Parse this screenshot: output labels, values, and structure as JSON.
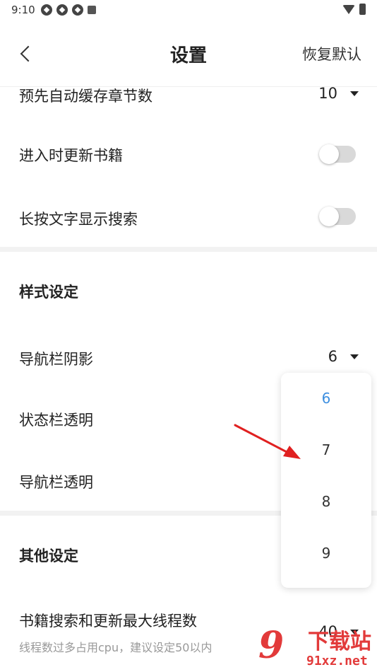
{
  "status_bar": {
    "time": "9:10"
  },
  "header": {
    "title": "设置",
    "restore_label": "恢复默认"
  },
  "settings": {
    "preload_chapters": {
      "label": "预先自动缓存章节数",
      "value": "10"
    },
    "update_on_enter": {
      "label": "进入时更新书籍",
      "on": false
    },
    "long_press_search": {
      "label": "长按文字显示搜索",
      "on": false
    },
    "style_section": "样式设定",
    "nav_shadow": {
      "label": "导航栏阴影",
      "value": "6"
    },
    "statusbar_transparent": {
      "label": "状态栏透明"
    },
    "navbar_transparent": {
      "label": "导航栏透明"
    },
    "other_section": "其他设定",
    "max_threads": {
      "label": "书籍搜索和更新最大线程数",
      "hint": "线程数过多占用cpu，建议设定50以内",
      "value": "40"
    }
  },
  "dropdown": {
    "options": [
      "6",
      "7",
      "8",
      "9"
    ],
    "selected": "6"
  },
  "colors": {
    "accent": "#3d8fe0",
    "annotation_arrow": "#e02020",
    "watermark": "#e23a3a"
  },
  "watermark": {
    "logo": "9",
    "title": "下载站",
    "url": "91xz.net"
  }
}
